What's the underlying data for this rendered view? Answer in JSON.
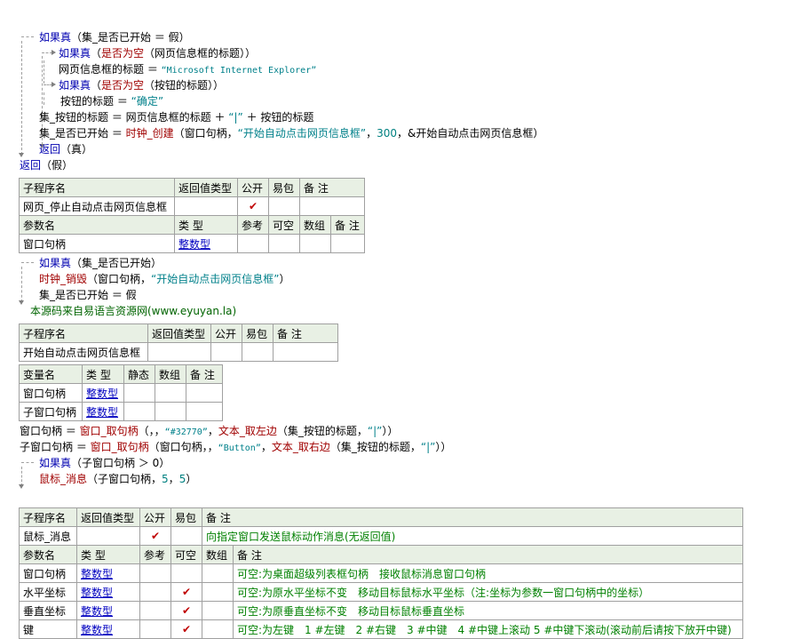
{
  "code1": {
    "line1": {
      "kw": "如果真",
      "rest": "（集_是否已开始 ＝ 假）"
    },
    "line2": {
      "kw": "如果真",
      "a": "（",
      "fn": "是否为空",
      "b": "（网页信息框的标题））"
    },
    "line3": {
      "a": "网页信息框的标题 ＝ ",
      "s": "“Microsoft Internet Explorer”"
    },
    "line4": {
      "kw": "如果真",
      "a": "（",
      "fn": "是否为空",
      "b": "（按钮的标题））"
    },
    "line5": {
      "a": "按钮的标题 ＝ ",
      "s": "“确定”"
    },
    "line6": {
      "a": "集_按钮的标题 ＝ 网页信息框的标题 ＋ ",
      "s": "“|”",
      "b": " ＋ 按钮的标题"
    },
    "line7": {
      "a": "集_是否已开始 ＝ ",
      "fn": "时钟_创建",
      "b": "（窗口句柄，",
      "s": "“开始自动点击网页信息框”",
      "c": "，",
      "n": "300",
      "d": "，&开始自动点击网页信息框）"
    },
    "line8": {
      "kw": "返回",
      "b": "（真）"
    },
    "line9": {
      "kw": "返回",
      "b": "（假）"
    }
  },
  "table1": {
    "header": [
      "子程序名",
      "返回值类型",
      "公开",
      "易包",
      "备 注"
    ],
    "row": [
      "网页_停止自动点击网页信息框",
      "",
      "✔",
      "",
      ""
    ],
    "pheader": [
      "参数名",
      "类 型",
      "参考",
      "可空",
      "数组",
      "备 注"
    ],
    "prow": [
      "窗口句柄",
      "整数型",
      "",
      "",
      "",
      ""
    ]
  },
  "code2": {
    "line1": {
      "kw": "如果真",
      "rest": "（集_是否已开始）"
    },
    "line2": {
      "fn": "时钟_销毁",
      "a": "（窗口句柄，",
      "s": "“开始自动点击网页信息框”",
      "b": "）"
    },
    "line3": {
      "a": "集_是否已开始 ＝ 假"
    },
    "comment": "本源码来自易语言资源网(www.eyuyan.la)"
  },
  "table2": {
    "header": [
      "子程序名",
      "返回值类型",
      "公开",
      "易包",
      "备 注"
    ],
    "row": [
      "开始自动点击网页信息框",
      "",
      "",
      "",
      ""
    ]
  },
  "table3": {
    "header": [
      "变量名",
      "类 型",
      "静态",
      "数组",
      "备 注"
    ],
    "rows": [
      [
        "窗口句柄",
        "整数型",
        "",
        "",
        ""
      ],
      [
        "子窗口句柄",
        "整数型",
        "",
        "",
        ""
      ]
    ]
  },
  "code3": {
    "line1": {
      "a": "窗口句柄 ＝ ",
      "fn": "窗口_取句柄",
      "b": "（，，",
      "s": "“#32770”",
      "c": "，",
      "fn2": "文本_取左边",
      "d": "（集_按钮的标题，",
      "s2": "“|”",
      "e": "））"
    },
    "line2": {
      "a": "子窗口句柄 ＝ ",
      "fn": "窗口_取句柄",
      "b": "（窗口句柄，，",
      "s": "“Button”",
      "c": "，",
      "fn2": "文本_取右边",
      "d": "（集_按钮的标题，",
      "s2": "“|”",
      "e": "））"
    },
    "line3": {
      "kw": "如果真",
      "rest": "（子窗口句柄 ＞ 0）"
    },
    "line4": {
      "fn": "鼠标_消息",
      "a": "（子窗口句柄，",
      "n1": "5",
      "b": "，",
      "n2": "5",
      "c": "）"
    }
  },
  "table4": {
    "header": [
      "子程序名",
      "返回值类型",
      "公开",
      "易包",
      "备 注"
    ],
    "row": [
      "鼠标_消息",
      "",
      "✔",
      "",
      "向指定窗口发送鼠标动作消息(无返回值)"
    ],
    "pheader": [
      "参数名",
      "类 型",
      "参考",
      "可空",
      "数组",
      "备 注"
    ],
    "prows": [
      [
        "窗口句柄",
        "整数型",
        "",
        "",
        "",
        "可空:为桌面超级列表框句柄　接收鼠标消息窗口句柄"
      ],
      [
        "水平坐标",
        "整数型",
        "",
        "✔",
        "",
        "可空:为原水平坐标不变　移动目标鼠标水平坐标（注:坐标为参数一窗口句柄中的坐标）"
      ],
      [
        "垂直坐标",
        "整数型",
        "",
        "✔",
        "",
        "可空:为原垂直坐标不变　移动目标鼠标垂直坐标"
      ],
      [
        "键",
        "整数型",
        "",
        "✔",
        "",
        "可空:为左键　1 #左键　2 #右键　3 #中键　4 #中键上滚动 5 #中键下滚动(滚动前后请按下放开中键)"
      ]
    ]
  }
}
